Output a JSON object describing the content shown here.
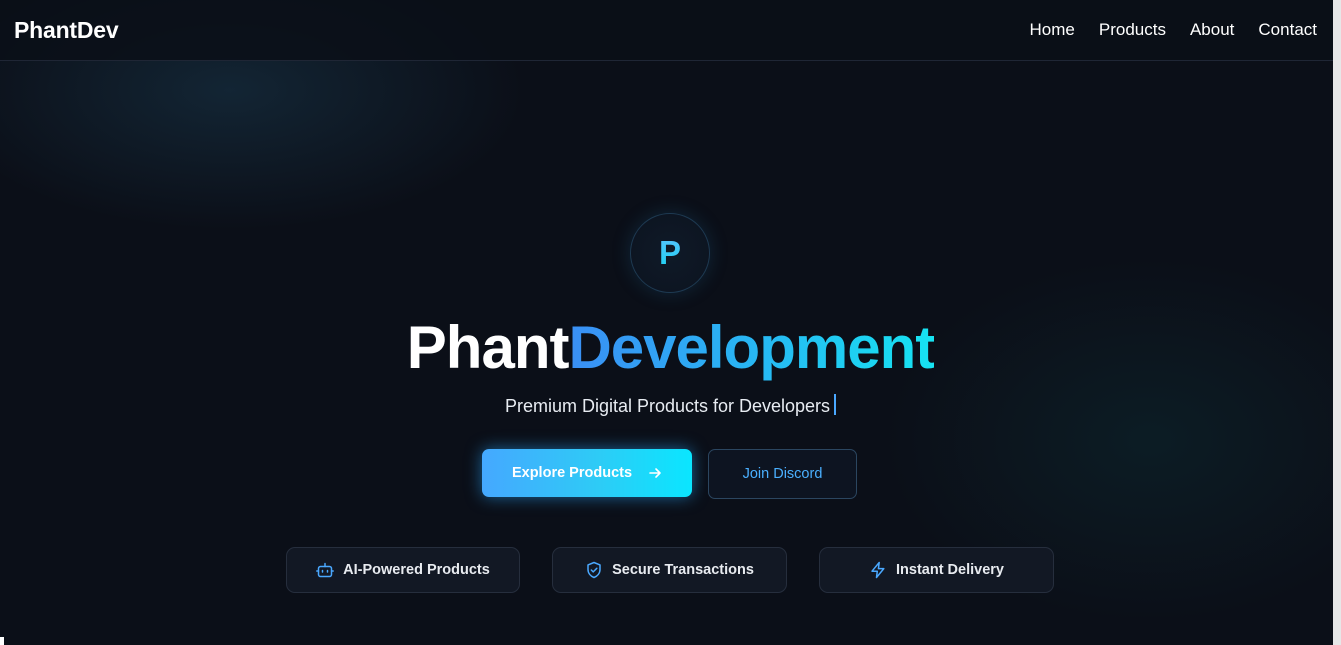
{
  "nav": {
    "brand": "PhantDev",
    "links": [
      "Home",
      "Products",
      "About",
      "Contact"
    ]
  },
  "hero": {
    "logo_letter": "P",
    "headline_part1": "Phant",
    "headline_part2": "Development",
    "subtitle": "Premium Digital Products for Developers",
    "primary_button": "Explore Products",
    "secondary_button": "Join Discord"
  },
  "features": [
    {
      "label": "AI-Powered Products",
      "icon": "robot-icon"
    },
    {
      "label": "Secure Transactions",
      "icon": "shield-check-icon"
    },
    {
      "label": "Instant Delivery",
      "icon": "lightning-icon"
    }
  ],
  "colors": {
    "background": "#0b0f18",
    "accent_blue": "#3a8ff5",
    "accent_cyan": "#16e4f2",
    "text": "#ffffff"
  }
}
